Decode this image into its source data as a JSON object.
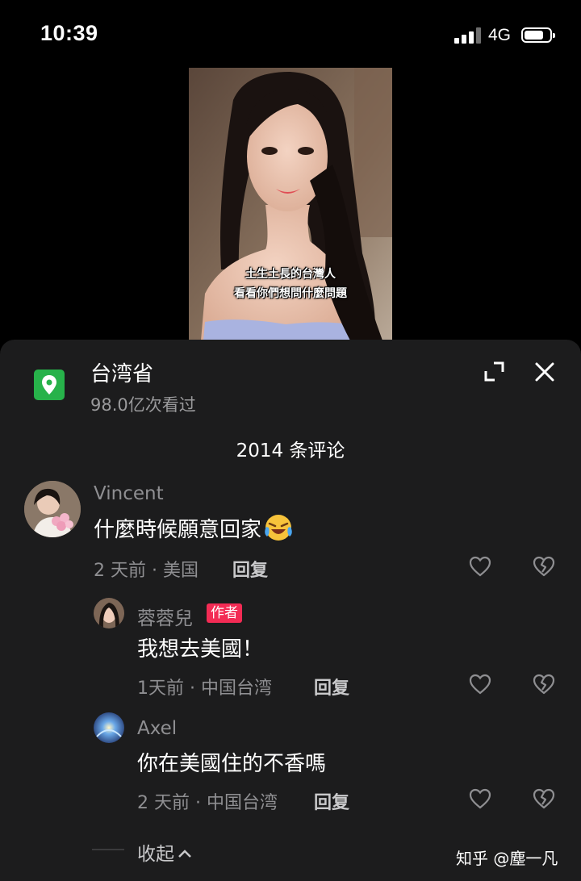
{
  "status_bar": {
    "time": "10:39",
    "network": "4G",
    "battery_level": 0.75
  },
  "video": {
    "caption_line1": "土生土長的台灣人",
    "caption_line2": "看看你們想問什麼問題"
  },
  "location": {
    "title": "台湾省",
    "views": "98.0亿次看过",
    "icon": "location-pin-icon"
  },
  "header": {
    "comment_count": "2014 条评论"
  },
  "comments": [
    {
      "username": "Vincent",
      "text": "什麼時候願意回家",
      "emoji": "laughing-crying-emoji",
      "meta": "2 天前 · 美国",
      "reply_label": "回复"
    },
    {
      "username": "蓉蓉兒",
      "badge": "作者",
      "text": "我想去美國！",
      "meta": "1天前 · 中国台湾",
      "reply_label": "回复"
    },
    {
      "username": "Axel",
      "text": "你在美國住的不香嗎",
      "meta": "2 天前 · 中国台湾",
      "reply_label": "回复"
    }
  ],
  "collapse_label": "收起",
  "watermark": "知乎 @塵一凡",
  "colors": {
    "sheet_bg": "#1c1c1d",
    "accent_green": "#27b24a",
    "badge_red": "#f32b54",
    "muted_text": "#8f8f92"
  }
}
